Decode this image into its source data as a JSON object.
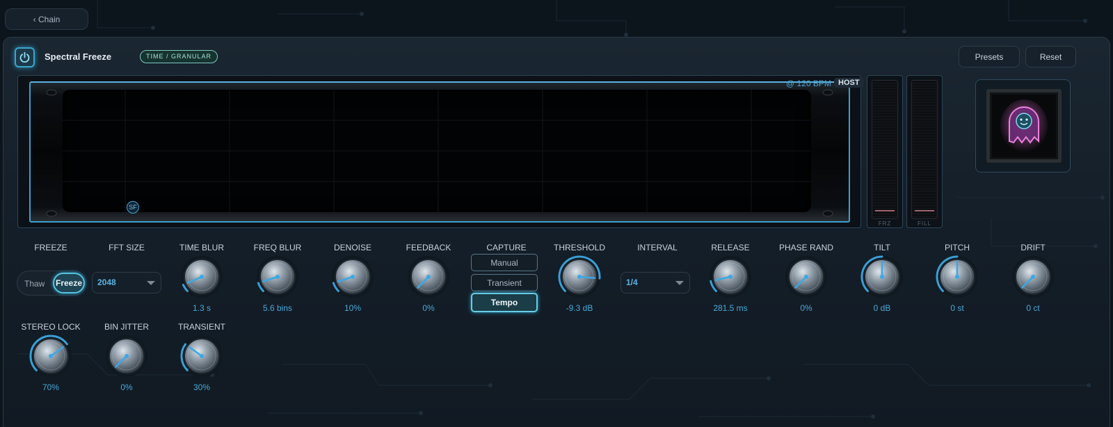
{
  "nav": {
    "back_label": "‹ Chain"
  },
  "plugin": {
    "title": "Spectral Freeze",
    "category": "TIME / GRANULAR",
    "presets_label": "Presets",
    "reset_label": "Reset",
    "power_icon": "power-icon"
  },
  "display": {
    "bpm": "@ 120 BPM",
    "host": "HOST",
    "badge": "SF",
    "meters": [
      {
        "label": "FRZ",
        "level": 0.0
      },
      {
        "label": "FILL",
        "level": 0.0
      }
    ]
  },
  "colors": {
    "accent": "#4ba8d8",
    "active": "#56c3e0",
    "panel": "#1a2631"
  },
  "controls": {
    "freeze": {
      "label": "FREEZE",
      "options": [
        "Thaw",
        "Freeze"
      ],
      "selected": "Freeze"
    },
    "fft_size": {
      "label": "FFT SIZE",
      "value": "2048"
    },
    "capture": {
      "label": "CAPTURE",
      "options": [
        "Manual",
        "Transient",
        "Tempo"
      ],
      "selected": "Tempo"
    },
    "interval": {
      "label": "INTERVAL",
      "value": "1/4"
    },
    "knobs": [
      {
        "id": "time-blur",
        "label": "TIME BLUR",
        "value": "1.3 s",
        "level": 0.08
      },
      {
        "id": "freq-blur",
        "label": "FREQ BLUR",
        "value": "5.6 bins",
        "level": 0.1
      },
      {
        "id": "denoise",
        "label": "DENOISE",
        "value": "10%",
        "level": 0.1
      },
      {
        "id": "feedback",
        "label": "FEEDBACK",
        "value": "0%",
        "level": 0.0
      },
      {
        "id": "threshold",
        "label": "THRESHOLD",
        "value": "-9.3 dB",
        "level": 0.85
      },
      {
        "id": "release",
        "label": "RELEASE",
        "value": "281.5 ms",
        "level": 0.12
      },
      {
        "id": "phase-rand",
        "label": "PHASE RAND",
        "value": "0%",
        "level": 0.0
      },
      {
        "id": "tilt",
        "label": "TILT",
        "value": "0 dB",
        "level": 0.5
      },
      {
        "id": "pitch",
        "label": "PITCH",
        "value": "0 st",
        "level": 0.5
      },
      {
        "id": "drift",
        "label": "DRIFT",
        "value": "0 ct",
        "level": 0.0
      },
      {
        "id": "stereo-lock",
        "label": "STEREO LOCK",
        "value": "70%",
        "level": 0.7
      },
      {
        "id": "bin-jitter",
        "label": "BIN JITTER",
        "value": "0%",
        "level": 0.0
      },
      {
        "id": "transient",
        "label": "TRANSIENT",
        "value": "30%",
        "level": 0.3
      }
    ]
  }
}
